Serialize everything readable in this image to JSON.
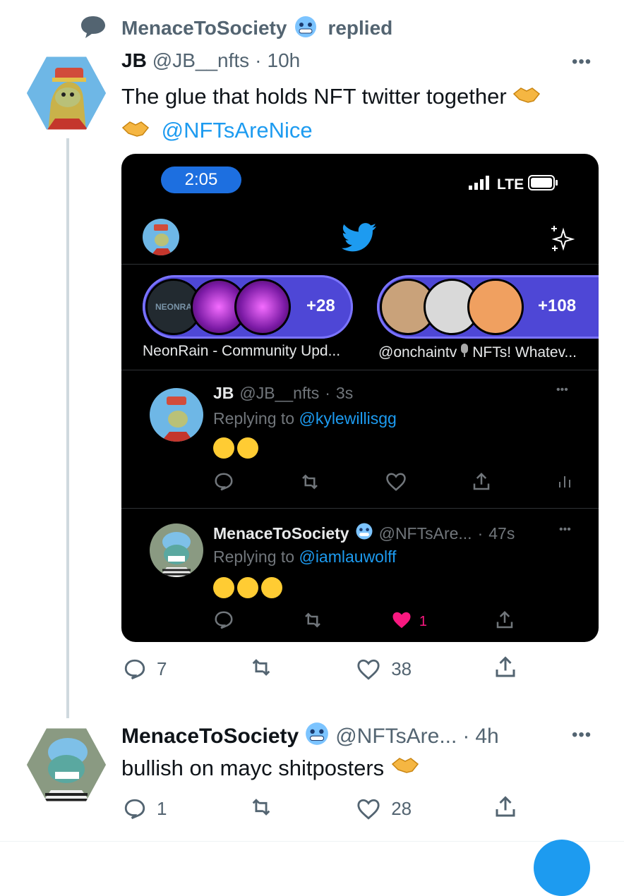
{
  "context": {
    "user": "MenaceToSociety",
    "action": "replied"
  },
  "tweet": {
    "name": "JB",
    "handle": "@JB__nfts",
    "sep": "·",
    "time": "10h",
    "text": "The glue that holds NFT twitter together",
    "mention": "@NFTsAreNice",
    "more": "•••",
    "actions": {
      "replies": "7",
      "likes": "38"
    }
  },
  "phone": {
    "status": {
      "time": "2:05",
      "network": "LTE"
    },
    "spaces": [
      {
        "label": "NeonRain - Community Upd...",
        "host_tag": "NEONRA",
        "count": "+28"
      },
      {
        "label_pre": "@onchaintv",
        "label_post": "NFTs! Whatev...",
        "count": "+108"
      }
    ],
    "tweets": [
      {
        "name": "JB",
        "handle": "@JB__nfts",
        "sep": "·",
        "time": "3s",
        "replying": "Replying to",
        "reply_to": "@kylewillisgg",
        "more": "•••"
      },
      {
        "name": "MenaceToSociety",
        "handle": "@NFTsAre...",
        "sep": "·",
        "time": "47s",
        "replying": "Replying to",
        "reply_to": "@iamlauwolff",
        "more": "•••",
        "likes": "1"
      }
    ]
  },
  "reply": {
    "name": "MenaceToSociety",
    "handle": "@NFTsAre...",
    "sep": "·",
    "time": "4h",
    "text": "bullish on mayc shitposters",
    "more": "•••",
    "actions": {
      "replies": "1",
      "likes": "28"
    }
  },
  "colors": {
    "accent": "#1d9bf0",
    "muted": "#536471",
    "like": "#f91880",
    "space_purple": "#4e47d6"
  },
  "icons": [
    "speech-bubble-icon",
    "cold-face-emoji-icon",
    "handshake-emoji-icon",
    "twitter-bird-icon",
    "sparkle-icon",
    "signal-icon",
    "battery-icon",
    "reply-icon",
    "retweet-icon",
    "like-icon",
    "share-icon",
    "analytics-icon",
    "laughing-emoji-icon",
    "crying-emoji-icon",
    "microphone-emoji-icon"
  ]
}
